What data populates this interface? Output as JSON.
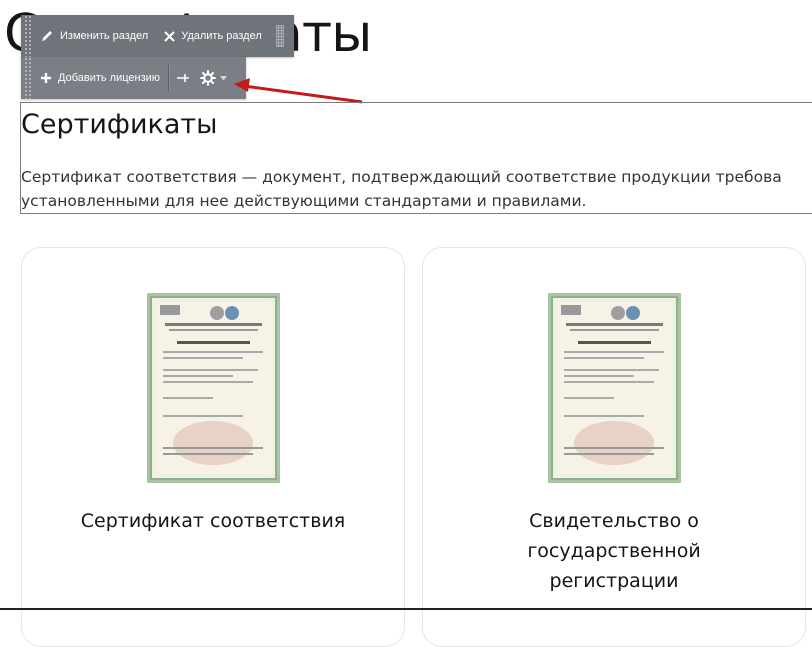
{
  "page": {
    "title": "Сертификаты"
  },
  "admin_toolbar": {
    "edit_section": "Изменить раздел",
    "delete_section": "Удалить раздел",
    "add_license": "Добавить лицензию"
  },
  "section": {
    "title": "Сертификаты",
    "description": "Сертификат соответствия — документ, подтверждающий соответствие продукции требова установленными для нее действующими стандартами и правилами."
  },
  "cards": [
    {
      "title": "Сертификат соответствия",
      "image_icon": "certificate-document"
    },
    {
      "title": "Свидетельство о государственной регистрации",
      "image_icon": "certificate-document"
    }
  ],
  "colors": {
    "toolbar": "#7b7e85",
    "arrow": "#c41a1a",
    "card_border": "#e6e6e6"
  }
}
